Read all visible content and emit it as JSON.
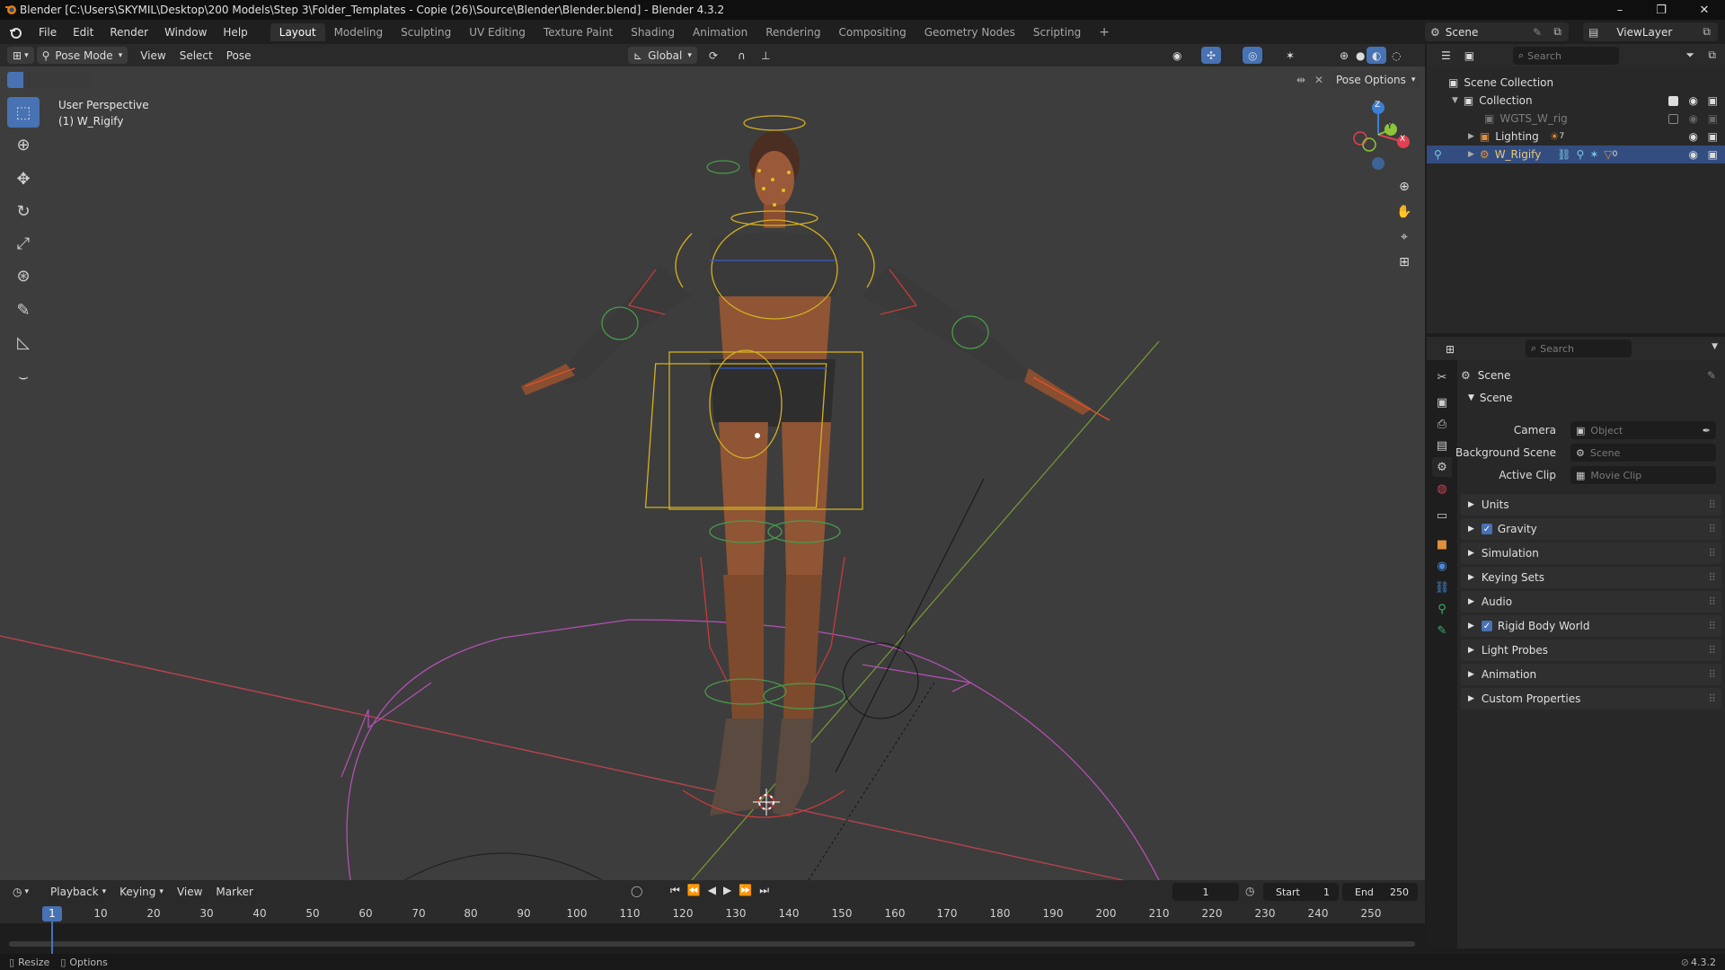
{
  "window": {
    "title": "Blender [C:\\Users\\SKYMIL\\Desktop\\200 Models\\Step 3\\Folder_Templates - Copie (26)\\Source\\Blender\\Blender.blend] - Blender 4.3.2",
    "minimize": "–",
    "maximize": "❐",
    "close": "✕"
  },
  "menu": [
    "File",
    "Edit",
    "Render",
    "Window",
    "Help"
  ],
  "workspaces": [
    "Layout",
    "Modeling",
    "Sculpting",
    "UV Editing",
    "Texture Paint",
    "Shading",
    "Animation",
    "Rendering",
    "Compositing",
    "Geometry Nodes",
    "Scripting"
  ],
  "workspace_add": "+",
  "scene_selector": {
    "label": "Scene"
  },
  "view_layer": {
    "label": "ViewLayer"
  },
  "viewport_header": {
    "mode": "Pose Mode",
    "menus": [
      "View",
      "Select",
      "Pose"
    ],
    "orientation": "Global",
    "pose_options": "Pose Options"
  },
  "viewport": {
    "perspective": "User Perspective",
    "active_object": "(1) W_Rigify",
    "gizmo_labels": {
      "x": "X",
      "y": "Y",
      "z": "Z"
    }
  },
  "outliner": {
    "search_placeholder": "Search",
    "items": [
      {
        "label": "Scene Collection",
        "indent": 0
      },
      {
        "label": "Collection",
        "indent": 1
      },
      {
        "label": "WGTS_W_rig",
        "indent": 2
      },
      {
        "label": "Lighting",
        "indent": 2,
        "badge": "7"
      },
      {
        "label": "W_Rigify",
        "indent": 2,
        "badge": "0",
        "selected": true
      }
    ]
  },
  "properties": {
    "search_placeholder": "Search",
    "header": "Scene",
    "section": "Scene",
    "fields": [
      {
        "label": "Camera",
        "placeholder": "Object"
      },
      {
        "label": "Background Scene",
        "placeholder": "Scene"
      },
      {
        "label": "Active Clip",
        "placeholder": "Movie Clip"
      }
    ],
    "panels": [
      {
        "label": "Units",
        "checkbox": false
      },
      {
        "label": "Gravity",
        "checkbox": true
      },
      {
        "label": "Simulation",
        "checkbox": false
      },
      {
        "label": "Keying Sets",
        "checkbox": false
      },
      {
        "label": "Audio",
        "checkbox": false
      },
      {
        "label": "Rigid Body World",
        "checkbox": true
      },
      {
        "label": "Light Probes",
        "checkbox": false
      },
      {
        "label": "Animation",
        "checkbox": false
      },
      {
        "label": "Custom Properties",
        "checkbox": false
      }
    ]
  },
  "timeline": {
    "menus": [
      "Playback",
      "Keying",
      "View",
      "Marker"
    ],
    "current_frame": "1",
    "start_label": "Start",
    "start": "1",
    "end_label": "End",
    "end": "250",
    "ticks": [
      "1",
      "10",
      "20",
      "30",
      "40",
      "50",
      "60",
      "70",
      "80",
      "90",
      "100",
      "110",
      "120",
      "130",
      "140",
      "150",
      "160",
      "170",
      "180",
      "190",
      "200",
      "210",
      "220",
      "230",
      "240",
      "250"
    ]
  },
  "statusbar": {
    "resize": "Resize",
    "options": "Options",
    "version": "4.3.2"
  },
  "colors": {
    "accent": "#4772b3",
    "selection": "#334d80",
    "x_axis": "#e04050",
    "y_axis": "#8cc43c",
    "z_axis": "#3d7fd6"
  }
}
